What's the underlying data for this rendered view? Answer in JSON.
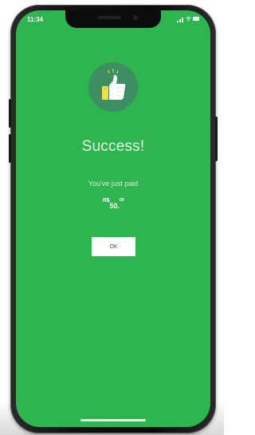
{
  "status_bar": {
    "time": "11:34",
    "icons": [
      "signal-icon",
      "wifi-icon",
      "battery-icon"
    ]
  },
  "badge": {
    "icon": "thumbs-up-icon"
  },
  "message": {
    "title": "Success!",
    "subtitle": "You've just paid",
    "amount_currency": "R$",
    "amount_main": "50.",
    "amount_cents": "00"
  },
  "actions": {
    "ok_label": "OK"
  },
  "colors": {
    "screen_background": "#2fb54f",
    "badge_background": "#3d8f63",
    "thumb_yellow": "#f3df4a",
    "button_background": "#ffffff"
  }
}
